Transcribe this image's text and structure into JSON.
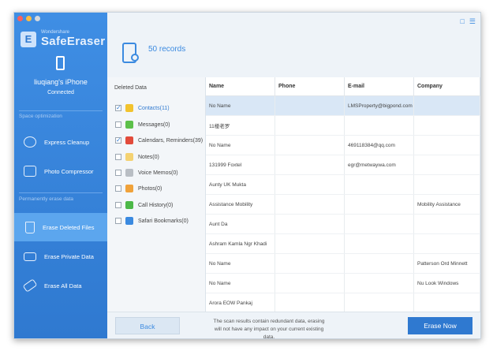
{
  "app": {
    "brand_sub": "Wondershare",
    "brand_name": "SafeEraser"
  },
  "device": {
    "name": "liuqiang's iPhone",
    "status": "Connected"
  },
  "sidebar": {
    "sections": [
      {
        "label": "Space optimization"
      },
      {
        "label": "Permanently erase data"
      }
    ],
    "items": [
      {
        "label": "Express Cleanup",
        "icon": "sweep-icon"
      },
      {
        "label": "Photo Compressor",
        "icon": "photo-icon"
      },
      {
        "label": "Erase Deleted Files",
        "icon": "trash-icon",
        "active": true
      },
      {
        "label": "Erase Private Data",
        "icon": "document-icon"
      },
      {
        "label": "Erase All Data",
        "icon": "eraser-icon"
      }
    ]
  },
  "header": {
    "records": "50 records"
  },
  "categories": {
    "title": "Deleted Data",
    "items": [
      {
        "label": "Contacts(11)",
        "checked": true,
        "selected": true,
        "color": "#f2c32e"
      },
      {
        "label": "Messages(0)",
        "checked": false,
        "color": "#5cc04a"
      },
      {
        "label": "Calendars, Reminders(39)",
        "checked": true,
        "color": "#e24b3b"
      },
      {
        "label": "Notes(0)",
        "checked": false,
        "color": "#f4d272"
      },
      {
        "label": "Voice Memos(0)",
        "checked": false,
        "color": "#b9bec4"
      },
      {
        "label": "Photos(0)",
        "checked": false,
        "color": "#f0a23a"
      },
      {
        "label": "Call History(0)",
        "checked": false,
        "color": "#4cb848"
      },
      {
        "label": "Safari Bookmarks(0)",
        "checked": false,
        "color": "#3b8ae0"
      }
    ]
  },
  "table": {
    "columns": [
      "Name",
      "Phone",
      "E-mail",
      "Company"
    ],
    "rows": [
      [
        "No Name",
        "",
        "LMSProperty@bigpond.com",
        ""
      ],
      [
        "11楼老罗",
        "",
        "",
        ""
      ],
      [
        "No Name",
        "",
        "469118384@qq.com",
        ""
      ],
      [
        "131999 Foxtel",
        "",
        "egr@metwaywa.com",
        ""
      ],
      [
        "Aunty UK Mukta",
        "",
        "",
        ""
      ],
      [
        "Assistance Mobility",
        "",
        "",
        "Mobility Assistance"
      ],
      [
        "Aunt Da",
        "",
        "",
        ""
      ],
      [
        "Ashram Kamla Ngr Khadi",
        "",
        "",
        ""
      ],
      [
        "No Name",
        "",
        "",
        "Patterson Ord Minnett"
      ],
      [
        "No Name",
        "",
        "",
        "Nu Look Windows"
      ],
      [
        "Arora EOW Pankaj",
        "",
        "",
        ""
      ],
      [
        "",
        "",
        "",
        ""
      ]
    ]
  },
  "footer": {
    "back_label": "Back",
    "notice": "The scan results contain redundant data, erasing will not have any impact on your current existing data.",
    "erase_label": "Erase Now"
  }
}
